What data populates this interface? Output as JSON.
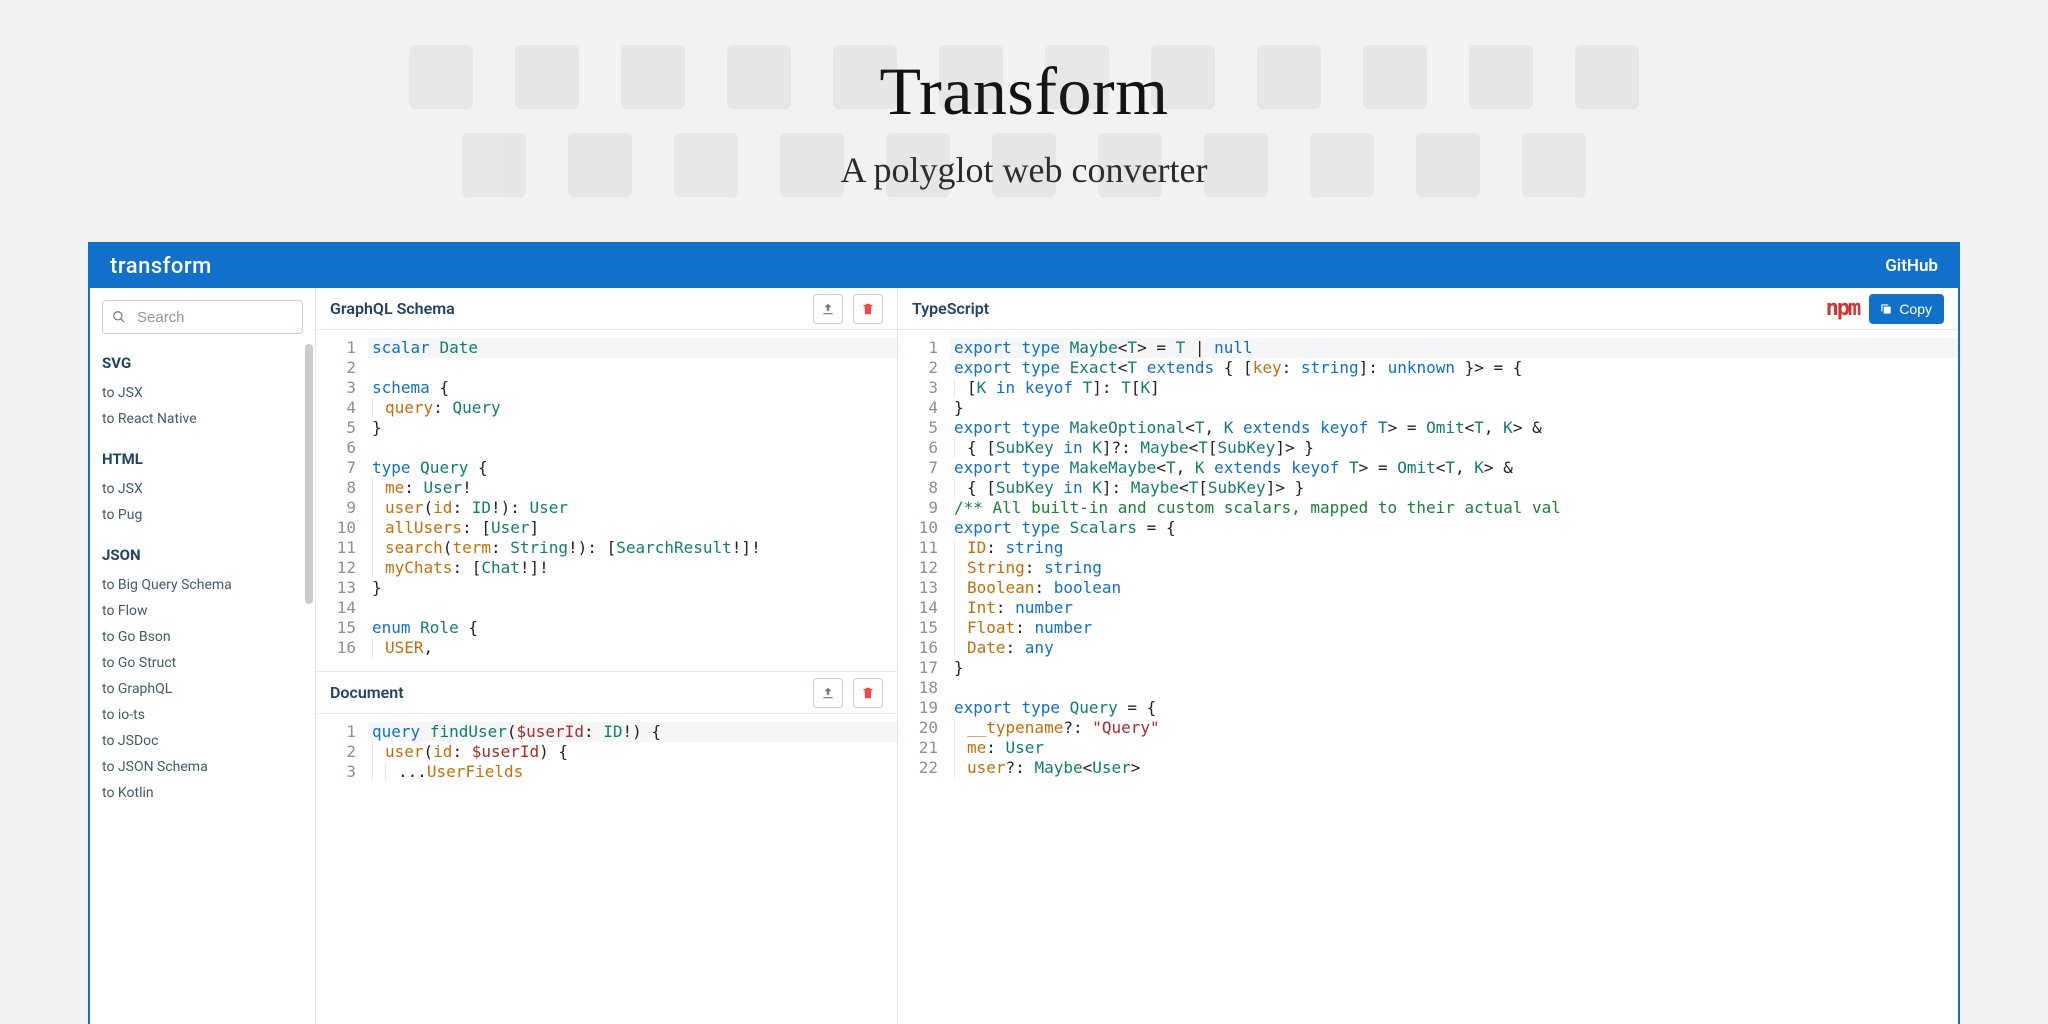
{
  "hero": {
    "title": "Transform",
    "subtitle": "A polyglot web converter"
  },
  "topbar": {
    "brand": "transform",
    "github": "GitHub"
  },
  "sidebar": {
    "search_placeholder": "Search",
    "sections": [
      {
        "heading": "SVG",
        "items": [
          "to JSX",
          "to React Native"
        ]
      },
      {
        "heading": "HTML",
        "items": [
          "to JSX",
          "to Pug"
        ]
      },
      {
        "heading": "JSON",
        "items": [
          "to Big Query Schema",
          "to Flow",
          "to Go Bson",
          "to Go Struct",
          "to GraphQL",
          "to io-ts",
          "to JSDoc",
          "to JSON Schema",
          "to Kotlin"
        ]
      }
    ]
  },
  "panels": {
    "schema": {
      "title": "GraphQL Schema",
      "code": [
        [
          [
            "kw",
            "scalar"
          ],
          [
            "sp",
            " "
          ],
          [
            "type",
            "Date"
          ]
        ],
        [],
        [
          [
            "kw",
            "schema"
          ],
          [
            "sp",
            " "
          ],
          [
            "op",
            "{"
          ]
        ],
        [
          [
            "guide"
          ],
          [
            "field",
            "query"
          ],
          [
            "op",
            ": "
          ],
          [
            "type",
            "Query"
          ]
        ],
        [
          [
            "op",
            "}"
          ]
        ],
        [],
        [
          [
            "kw",
            "type"
          ],
          [
            "sp",
            " "
          ],
          [
            "type",
            "Query"
          ],
          [
            "sp",
            " "
          ],
          [
            "op",
            "{"
          ]
        ],
        [
          [
            "guide"
          ],
          [
            "field",
            "me"
          ],
          [
            "op",
            ": "
          ],
          [
            "type",
            "User"
          ],
          [
            "op",
            "!"
          ]
        ],
        [
          [
            "guide"
          ],
          [
            "field",
            "user"
          ],
          [
            "op",
            "("
          ],
          [
            "field",
            "id"
          ],
          [
            "op",
            ": "
          ],
          [
            "type",
            "ID"
          ],
          [
            "op",
            "!): "
          ],
          [
            "type",
            "User"
          ]
        ],
        [
          [
            "guide"
          ],
          [
            "field",
            "allUsers"
          ],
          [
            "op",
            ": ["
          ],
          [
            "type",
            "User"
          ],
          [
            "op",
            "]"
          ]
        ],
        [
          [
            "guide"
          ],
          [
            "field",
            "search"
          ],
          [
            "op",
            "("
          ],
          [
            "field",
            "term"
          ],
          [
            "op",
            ": "
          ],
          [
            "type",
            "String"
          ],
          [
            "op",
            "!): ["
          ],
          [
            "type",
            "SearchResult"
          ],
          [
            "op",
            "!]!"
          ]
        ],
        [
          [
            "guide"
          ],
          [
            "field",
            "myChats"
          ],
          [
            "op",
            ": ["
          ],
          [
            "type",
            "Chat"
          ],
          [
            "op",
            "!]!"
          ]
        ],
        [
          [
            "op",
            "}"
          ]
        ],
        [],
        [
          [
            "kw",
            "enum"
          ],
          [
            "sp",
            " "
          ],
          [
            "type",
            "Role"
          ],
          [
            "sp",
            " "
          ],
          [
            "op",
            "{"
          ]
        ],
        [
          [
            "guide"
          ],
          [
            "prop",
            "USER"
          ],
          [
            "op",
            ","
          ]
        ]
      ]
    },
    "document": {
      "title": "Document",
      "code": [
        [
          [
            "kw",
            "query"
          ],
          [
            "sp",
            " "
          ],
          [
            "type",
            "findUser"
          ],
          [
            "op",
            "("
          ],
          [
            "str",
            "$userId"
          ],
          [
            "op",
            ": "
          ],
          [
            "type",
            "ID"
          ],
          [
            "op",
            "!) {"
          ]
        ],
        [
          [
            "guide"
          ],
          [
            "field",
            "user"
          ],
          [
            "op",
            "("
          ],
          [
            "field",
            "id"
          ],
          [
            "op",
            ": "
          ],
          [
            "str",
            "$userId"
          ],
          [
            "op",
            ") {"
          ]
        ],
        [
          [
            "guide"
          ],
          [
            "guide"
          ],
          [
            "op",
            "..."
          ],
          [
            "prop",
            "UserFields"
          ]
        ]
      ]
    },
    "output": {
      "title": "TypeScript",
      "npm_label": "npm",
      "copy_label": "Copy",
      "code": [
        [
          [
            "kw",
            "export"
          ],
          [
            "sp",
            " "
          ],
          [
            "kw",
            "type"
          ],
          [
            "sp",
            " "
          ],
          [
            "type",
            "Maybe"
          ],
          [
            "op",
            "<"
          ],
          [
            "type",
            "T"
          ],
          [
            "op",
            "> = "
          ],
          [
            "type",
            "T"
          ],
          [
            "op",
            " | "
          ],
          [
            "builtin",
            "null"
          ]
        ],
        [
          [
            "kw",
            "export"
          ],
          [
            "sp",
            " "
          ],
          [
            "kw",
            "type"
          ],
          [
            "sp",
            " "
          ],
          [
            "type",
            "Exact"
          ],
          [
            "op",
            "<"
          ],
          [
            "type",
            "T"
          ],
          [
            "sp",
            " "
          ],
          [
            "kw",
            "extends"
          ],
          [
            "sp",
            " "
          ],
          [
            "op",
            "{ ["
          ],
          [
            "field",
            "key"
          ],
          [
            "op",
            ": "
          ],
          [
            "builtin",
            "string"
          ],
          [
            "op",
            "]: "
          ],
          [
            "builtin",
            "unknown"
          ],
          [
            "op",
            " }> = {"
          ]
        ],
        [
          [
            "guide"
          ],
          [
            "op",
            "["
          ],
          [
            "type",
            "K"
          ],
          [
            "sp",
            " "
          ],
          [
            "kw",
            "in"
          ],
          [
            "sp",
            " "
          ],
          [
            "kw",
            "keyof"
          ],
          [
            "sp",
            " "
          ],
          [
            "type",
            "T"
          ],
          [
            "op",
            "]: "
          ],
          [
            "type",
            "T"
          ],
          [
            "op",
            "["
          ],
          [
            "type",
            "K"
          ],
          [
            "op",
            "]"
          ]
        ],
        [
          [
            "op",
            "}"
          ]
        ],
        [
          [
            "kw",
            "export"
          ],
          [
            "sp",
            " "
          ],
          [
            "kw",
            "type"
          ],
          [
            "sp",
            " "
          ],
          [
            "type",
            "MakeOptional"
          ],
          [
            "op",
            "<"
          ],
          [
            "type",
            "T"
          ],
          [
            "op",
            ", "
          ],
          [
            "type",
            "K"
          ],
          [
            "sp",
            " "
          ],
          [
            "kw",
            "extends"
          ],
          [
            "sp",
            " "
          ],
          [
            "kw",
            "keyof"
          ],
          [
            "sp",
            " "
          ],
          [
            "type",
            "T"
          ],
          [
            "op",
            "> = "
          ],
          [
            "type",
            "Omit"
          ],
          [
            "op",
            "<"
          ],
          [
            "type",
            "T"
          ],
          [
            "op",
            ", "
          ],
          [
            "type",
            "K"
          ],
          [
            "op",
            "> &"
          ]
        ],
        [
          [
            "guide"
          ],
          [
            "op",
            "{ ["
          ],
          [
            "type",
            "SubKey"
          ],
          [
            "sp",
            " "
          ],
          [
            "kw",
            "in"
          ],
          [
            "sp",
            " "
          ],
          [
            "type",
            "K"
          ],
          [
            "op",
            "]?: "
          ],
          [
            "type",
            "Maybe"
          ],
          [
            "op",
            "<"
          ],
          [
            "type",
            "T"
          ],
          [
            "op",
            "["
          ],
          [
            "type",
            "SubKey"
          ],
          [
            "op",
            "]> }"
          ]
        ],
        [
          [
            "kw",
            "export"
          ],
          [
            "sp",
            " "
          ],
          [
            "kw",
            "type"
          ],
          [
            "sp",
            " "
          ],
          [
            "type",
            "MakeMaybe"
          ],
          [
            "op",
            "<"
          ],
          [
            "type",
            "T"
          ],
          [
            "op",
            ", "
          ],
          [
            "type",
            "K"
          ],
          [
            "sp",
            " "
          ],
          [
            "kw",
            "extends"
          ],
          [
            "sp",
            " "
          ],
          [
            "kw",
            "keyof"
          ],
          [
            "sp",
            " "
          ],
          [
            "type",
            "T"
          ],
          [
            "op",
            "> = "
          ],
          [
            "type",
            "Omit"
          ],
          [
            "op",
            "<"
          ],
          [
            "type",
            "T"
          ],
          [
            "op",
            ", "
          ],
          [
            "type",
            "K"
          ],
          [
            "op",
            "> &"
          ]
        ],
        [
          [
            "guide"
          ],
          [
            "op",
            "{ ["
          ],
          [
            "type",
            "SubKey"
          ],
          [
            "sp",
            " "
          ],
          [
            "kw",
            "in"
          ],
          [
            "sp",
            " "
          ],
          [
            "type",
            "K"
          ],
          [
            "op",
            "]: "
          ],
          [
            "type",
            "Maybe"
          ],
          [
            "op",
            "<"
          ],
          [
            "type",
            "T"
          ],
          [
            "op",
            "["
          ],
          [
            "type",
            "SubKey"
          ],
          [
            "op",
            "]> }"
          ]
        ],
        [
          [
            "comment",
            "/** All built-in and custom scalars, mapped to their actual val"
          ]
        ],
        [
          [
            "kw",
            "export"
          ],
          [
            "sp",
            " "
          ],
          [
            "kw",
            "type"
          ],
          [
            "sp",
            " "
          ],
          [
            "type",
            "Scalars"
          ],
          [
            "op",
            " = {"
          ]
        ],
        [
          [
            "guide"
          ],
          [
            "field",
            "ID"
          ],
          [
            "op",
            ": "
          ],
          [
            "builtin",
            "string"
          ]
        ],
        [
          [
            "guide"
          ],
          [
            "field",
            "String"
          ],
          [
            "op",
            ": "
          ],
          [
            "builtin",
            "string"
          ]
        ],
        [
          [
            "guide"
          ],
          [
            "field",
            "Boolean"
          ],
          [
            "op",
            ": "
          ],
          [
            "builtin",
            "boolean"
          ]
        ],
        [
          [
            "guide"
          ],
          [
            "field",
            "Int"
          ],
          [
            "op",
            ": "
          ],
          [
            "builtin",
            "number"
          ]
        ],
        [
          [
            "guide"
          ],
          [
            "field",
            "Float"
          ],
          [
            "op",
            ": "
          ],
          [
            "builtin",
            "number"
          ]
        ],
        [
          [
            "guide"
          ],
          [
            "field",
            "Date"
          ],
          [
            "op",
            ": "
          ],
          [
            "builtin",
            "any"
          ]
        ],
        [
          [
            "op",
            "}"
          ]
        ],
        [],
        [
          [
            "kw",
            "export"
          ],
          [
            "sp",
            " "
          ],
          [
            "kw",
            "type"
          ],
          [
            "sp",
            " "
          ],
          [
            "type",
            "Query"
          ],
          [
            "op",
            " = {"
          ]
        ],
        [
          [
            "guide"
          ],
          [
            "field",
            "__typename"
          ],
          [
            "op",
            "?: "
          ],
          [
            "str",
            "\"Query\""
          ]
        ],
        [
          [
            "guide"
          ],
          [
            "field",
            "me"
          ],
          [
            "op",
            ": "
          ],
          [
            "type",
            "User"
          ]
        ],
        [
          [
            "guide"
          ],
          [
            "field",
            "user"
          ],
          [
            "op",
            "?: "
          ],
          [
            "type",
            "Maybe"
          ],
          [
            "op",
            "<"
          ],
          [
            "type",
            "User"
          ],
          [
            "op",
            ">"
          ]
        ]
      ]
    }
  }
}
